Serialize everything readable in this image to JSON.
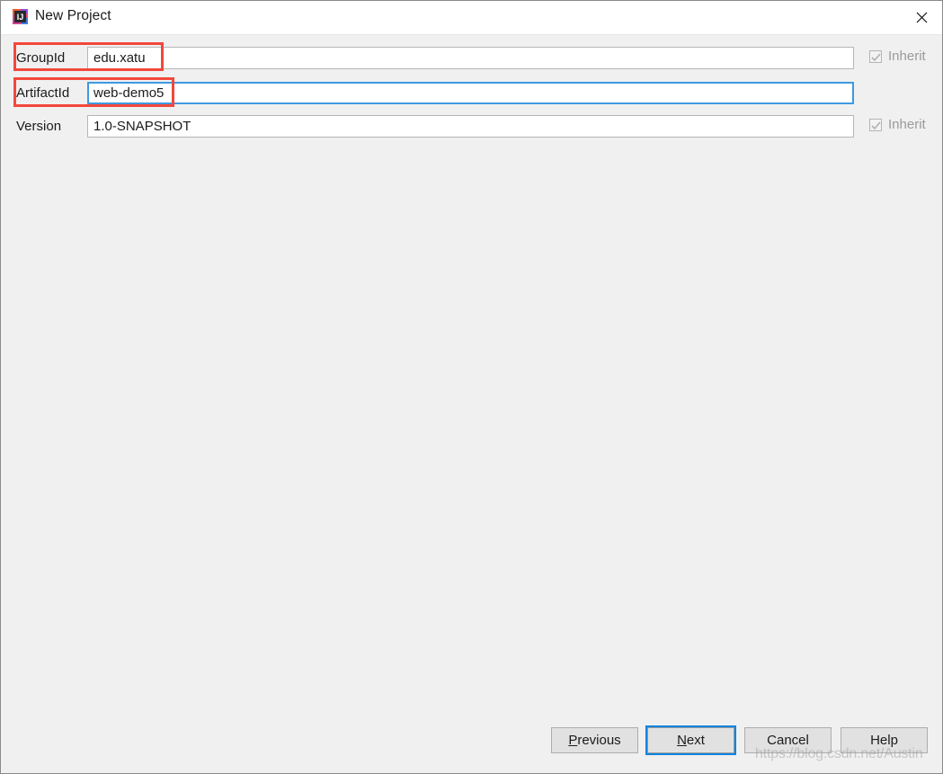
{
  "window": {
    "title": "New Project",
    "app_icon": "intellij-idea-icon",
    "close_icon": "close-icon"
  },
  "form": {
    "rows": [
      {
        "label": "GroupId",
        "value": "edu.xatu",
        "focused": false,
        "inherit": {
          "label": "Inherit",
          "checked": true,
          "enabled": false
        },
        "annotated": true
      },
      {
        "label": "ArtifactId",
        "value": "web-demo5",
        "focused": true,
        "inherit": null,
        "annotated": true
      },
      {
        "label": "Version",
        "value": "1.0-SNAPSHOT",
        "focused": false,
        "inherit": {
          "label": "Inherit",
          "checked": true,
          "enabled": false
        },
        "annotated": false
      }
    ]
  },
  "buttons": {
    "previous": {
      "prefix": "",
      "mnemonic": "P",
      "suffix": "revious"
    },
    "next": {
      "prefix": "",
      "mnemonic": "N",
      "suffix": "ext"
    },
    "cancel": {
      "prefix": "Cancel",
      "mnemonic": "",
      "suffix": ""
    },
    "help": {
      "prefix": "Help",
      "mnemonic": "",
      "suffix": ""
    }
  },
  "watermark": {
    "text": "https://blog.csdn.net/Austin"
  },
  "colors": {
    "dialog_bg": "#f0f0f0",
    "titlebar_bg": "#ffffff",
    "focus_blue": "#3d9ae0",
    "button_focus_blue": "#0a84e0",
    "annotation_red": "#f2483c",
    "button_bg": "#e1e1e1",
    "disabled_text": "#9a9a9a"
  }
}
